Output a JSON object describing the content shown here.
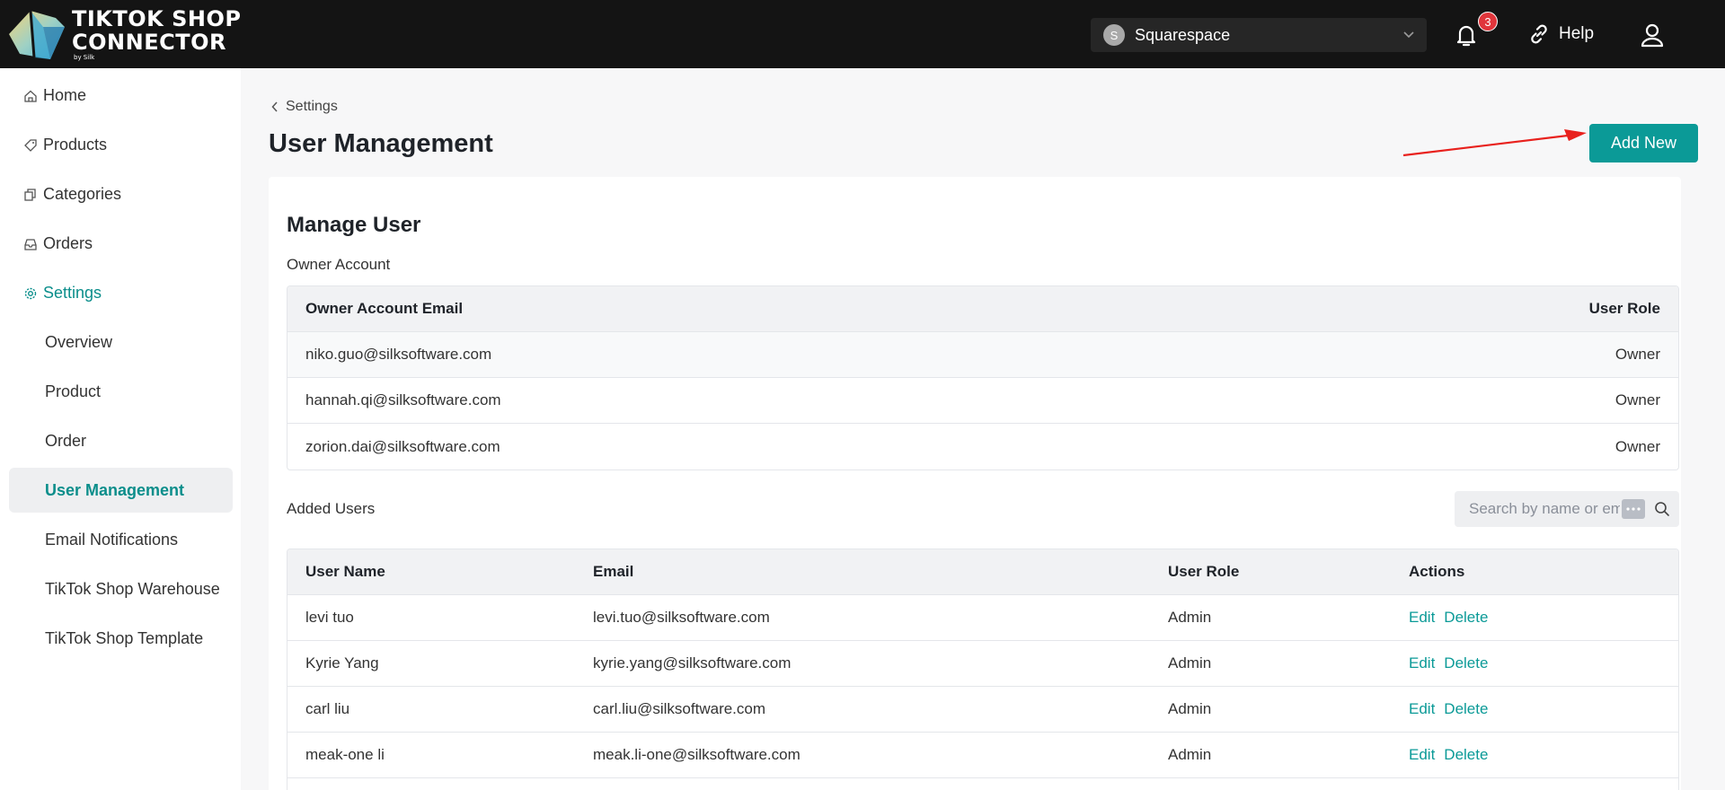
{
  "brand": {
    "line1": "TIKTOK SHOP",
    "line2": "CONNECTOR",
    "line3": "by Silk"
  },
  "header": {
    "store": {
      "avatar_letter": "S",
      "name": "Squarespace"
    },
    "notifications_count": "3",
    "help_label": "Help"
  },
  "sidebar": {
    "items": [
      {
        "label": "Home",
        "icon": "home-icon"
      },
      {
        "label": "Products",
        "icon": "tag-icon"
      },
      {
        "label": "Categories",
        "icon": "copy-icon"
      },
      {
        "label": "Orders",
        "icon": "inbox-icon"
      },
      {
        "label": "Settings",
        "icon": "gear-icon",
        "active": true
      }
    ],
    "sub_items": [
      {
        "label": "Overview"
      },
      {
        "label": "Product"
      },
      {
        "label": "Order"
      },
      {
        "label": "User Management",
        "active": true
      },
      {
        "label": "Email Notifications"
      },
      {
        "label": "TikTok Shop Warehouse"
      },
      {
        "label": "TikTok Shop Template"
      }
    ]
  },
  "main": {
    "breadcrumb": "Settings",
    "title": "User Management",
    "add_button": "Add New",
    "card_title": "Manage User",
    "owner_section": {
      "label": "Owner Account",
      "headers": {
        "email": "Owner Account Email",
        "role": "User Role"
      },
      "rows": [
        {
          "email": "niko.guo@silksoftware.com",
          "role": "Owner"
        },
        {
          "email": "hannah.qi@silksoftware.com",
          "role": "Owner"
        },
        {
          "email": "zorion.dai@silksoftware.com",
          "role": "Owner"
        }
      ]
    },
    "added_section": {
      "label": "Added Users",
      "search_value": "Search by name or em",
      "headers": {
        "name": "User Name",
        "email": "Email",
        "role": "User Role",
        "actions": "Actions"
      },
      "rows": [
        {
          "name": "levi tuo",
          "email": "levi.tuo@silksoftware.com",
          "role": "Admin",
          "edit": "Edit",
          "delete": "Delete"
        },
        {
          "name": "Kyrie Yang",
          "email": "kyrie.yang@silksoftware.com",
          "role": "Admin",
          "edit": "Edit",
          "delete": "Delete"
        },
        {
          "name": "carl liu",
          "email": "carl.liu@silksoftware.com",
          "role": "Admin",
          "edit": "Edit",
          "delete": "Delete"
        },
        {
          "name": "meak-one li",
          "email": "meak.li-one@silksoftware.com",
          "role": "Admin",
          "edit": "Edit",
          "delete": "Delete"
        }
      ]
    }
  },
  "colors": {
    "accent": "#0b9a97",
    "topbar": "#141414",
    "annotation_arrow": "#e8211d",
    "badge": "#e0353b"
  }
}
